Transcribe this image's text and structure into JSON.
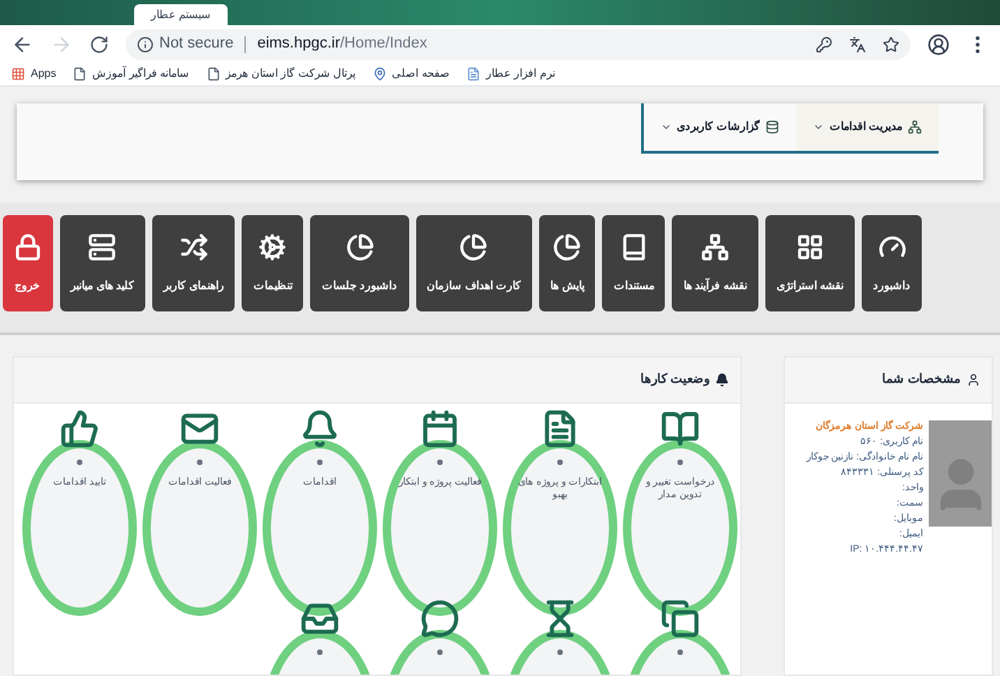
{
  "browser": {
    "tab_title": "سیستم عطار",
    "security": "Not secure",
    "url_host": "eims.hpgc.ir",
    "url_path": "/Home/Index",
    "bookmarks": [
      {
        "label": "نرم افزار عطار",
        "kind": "doc"
      },
      {
        "label": "صفحه اصلی",
        "kind": "pin"
      },
      {
        "label": "پرتال شرکت گاز استان هرمز",
        "kind": "page"
      },
      {
        "label": "سامانه فراگیر آموزش",
        "kind": "page"
      },
      {
        "label": "Apps",
        "kind": "apps"
      }
    ]
  },
  "nav": [
    {
      "label": "مدیریت اقدامات",
      "kind": "sitemap",
      "selected": true
    },
    {
      "label": "گزارشات کاربردی",
      "kind": "database",
      "selected": false
    }
  ],
  "tiles": [
    {
      "label": "داشبورد",
      "kind": "gauge",
      "danger": false
    },
    {
      "label": "نقشه استراتژی",
      "kind": "grid",
      "danger": false
    },
    {
      "label": "نقشه فرآیند ها",
      "kind": "tree",
      "danger": false
    },
    {
      "label": "مستندات",
      "kind": "book",
      "danger": false
    },
    {
      "label": "پایش ها",
      "kind": "pie",
      "danger": false
    },
    {
      "label": "کارت اهداف سازمان",
      "kind": "pie",
      "danger": false
    },
    {
      "label": "داشبورد جلسات",
      "kind": "pie",
      "danger": false
    },
    {
      "label": "تنظیمات",
      "kind": "cogs",
      "danger": false
    },
    {
      "label": "راهنمای کاربر",
      "kind": "shuffle",
      "danger": false
    },
    {
      "label": "کلید های میانبر",
      "kind": "server",
      "danger": false
    },
    {
      "label": "خروج",
      "kind": "lock",
      "danger": true
    }
  ],
  "profile": {
    "title": "مشخصات شما",
    "company": "شرکت گاز استان هرمزگان",
    "lines": [
      "نام کاربری: ۵۶۰",
      "نام نام خانوادگی: نازنین جوکار",
      "کد پرسنلی: ۸۴۳۳۳۱",
      "واحد:",
      "سمت:",
      "موبایل:",
      "ایمیل:",
      "IP: ۱۰.۴۴۴.۴۴.۴۷"
    ]
  },
  "tasks": {
    "title": "وضعیت کارها",
    "items": [
      {
        "label": "درخواست تغییر و تدوین مدار",
        "kind": "book"
      },
      {
        "label": "ابتکارات و پروژه های بهبو",
        "kind": "file"
      },
      {
        "label": "فعالیت پروژه و ابتکار",
        "kind": "calendar"
      },
      {
        "label": "اقدامات",
        "kind": "bell"
      },
      {
        "label": "فعالیت اقدامات",
        "kind": "mail"
      },
      {
        "label": "تایید اقدامات",
        "kind": "like"
      },
      {
        "kind": "copy"
      },
      {
        "kind": "hourglass"
      },
      {
        "kind": "comment"
      },
      {
        "kind": "inbox"
      }
    ]
  }
}
